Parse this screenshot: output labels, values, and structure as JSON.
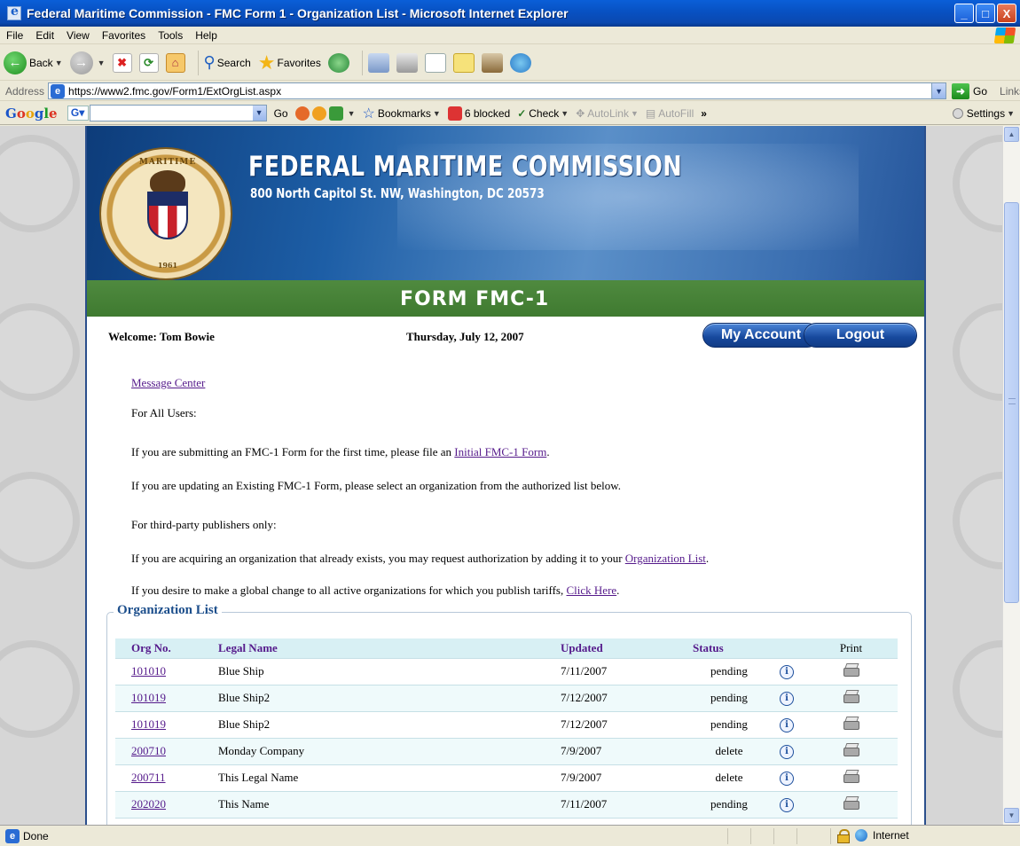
{
  "window": {
    "title": "Federal Maritime Commission - FMC Form 1 - Organization List - Microsoft Internet Explorer",
    "buttons": {
      "minimize": "_",
      "maximize": "□",
      "close": "X"
    }
  },
  "menu": [
    "File",
    "Edit",
    "View",
    "Favorites",
    "Tools",
    "Help"
  ],
  "toolbar": {
    "back": "Back",
    "search": "Search",
    "favorites": "Favorites"
  },
  "address": {
    "label": "Address",
    "url": "https://www2.fmc.gov/Form1/ExtOrgList.aspx",
    "go": "Go",
    "links": "Links"
  },
  "googlebar": {
    "logo_g": "G",
    "logo_o1": "o",
    "logo_o2": "o",
    "logo_g2": "g",
    "logo_l": "l",
    "logo_e": "e",
    "go": "Go",
    "bookmarks": "Bookmarks",
    "blocked": "6 blocked",
    "check": "Check",
    "autolink": "AutoLink",
    "autofill": "AutoFill",
    "settings": "Settings"
  },
  "banner": {
    "agency": "FEDERAL MARITIME COMMISSION",
    "address": "800 North Capitol St. NW, Washington, DC 20573",
    "form_title": "FORM FMC-1",
    "seal_text": "MARITIME",
    "seal_year": "1961"
  },
  "userbar": {
    "welcome": "Welcome:  Tom Bowie",
    "date": "Thursday, July 12, 2007",
    "my_account": "My Account",
    "logout": "Logout"
  },
  "content": {
    "message_center": "Message Center",
    "all_users": "For All Users:",
    "first_time_prefix": "If you are submitting an FMC-1 Form for the first time, please file an ",
    "first_time_link": "Initial FMC-1 Form",
    "first_time_suffix": ".",
    "updating": "If you are updating an Existing FMC-1 Form, please select an organization from the authorized list below.",
    "third_party": "For third-party publishers only:",
    "acquiring_prefix": "If you are acquiring an organization that already exists, you may request authorization by adding it to your ",
    "acquiring_link": "Organization List",
    "acquiring_suffix": ".",
    "global_prefix": "If you desire to make a global change to all active organizations for which you publish tariffs, ",
    "global_link": "Click Here",
    "global_suffix": "."
  },
  "org_list": {
    "legend": "Organization List",
    "headers": {
      "org_no": "Org No.",
      "legal_name": "Legal Name",
      "updated": "Updated",
      "status": "Status",
      "print": "Print"
    },
    "rows": [
      {
        "org_no": "101010",
        "legal_name": "Blue Ship",
        "updated": "7/11/2007",
        "status": "pending"
      },
      {
        "org_no": "101019",
        "legal_name": "Blue Ship2",
        "updated": "7/12/2007",
        "status": "pending"
      },
      {
        "org_no": "101019",
        "legal_name": "Blue Ship2",
        "updated": "7/12/2007",
        "status": "pending"
      },
      {
        "org_no": "200710",
        "legal_name": "Monday Company",
        "updated": "7/9/2007",
        "status": "delete"
      },
      {
        "org_no": "200711",
        "legal_name": "This Legal Name",
        "updated": "7/9/2007",
        "status": "delete"
      },
      {
        "org_no": "202020",
        "legal_name": "This Name",
        "updated": "7/11/2007",
        "status": "pending"
      }
    ]
  },
  "statusbar": {
    "status": "Done",
    "zone": "Internet"
  }
}
